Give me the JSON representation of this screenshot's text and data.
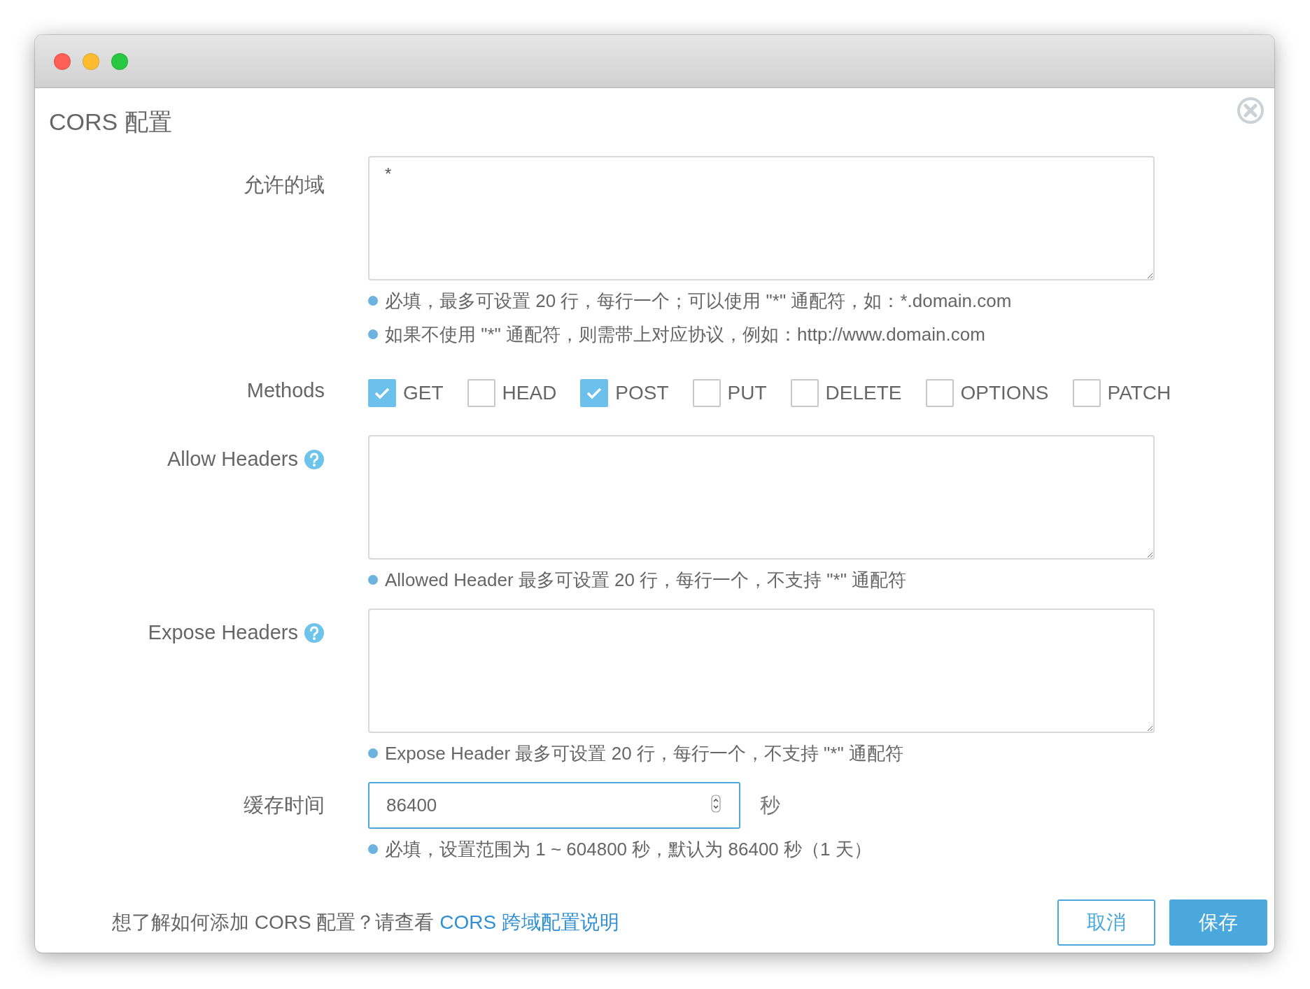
{
  "window": {
    "title": "CORS 配置"
  },
  "allowed_origins": {
    "label": "允许的域",
    "value": "*",
    "hints": [
      "必填，最多可设置 20 行，每行一个；可以使用 \"*\" 通配符，如：*.domain.com",
      "如果不使用 \"*\" 通配符，则需带上对应协议，例如：http://www.domain.com"
    ]
  },
  "methods": {
    "label": "Methods",
    "options": [
      {
        "label": "GET",
        "checked": true
      },
      {
        "label": "HEAD",
        "checked": false
      },
      {
        "label": "POST",
        "checked": true
      },
      {
        "label": "PUT",
        "checked": false
      },
      {
        "label": "DELETE",
        "checked": false
      },
      {
        "label": "OPTIONS",
        "checked": false
      },
      {
        "label": "PATCH",
        "checked": false
      }
    ]
  },
  "allow_headers": {
    "label": "Allow Headers",
    "has_help": true,
    "hints": [
      "Allowed Header 最多可设置 20 行，每行一个，不支持 \"*\" 通配符"
    ]
  },
  "expose_headers": {
    "label": "Expose Headers",
    "has_help": true,
    "hints": [
      "Expose Header 最多可设置 20 行，每行一个，不支持 \"*\" 通配符"
    ]
  },
  "cache_time": {
    "label": "缓存时间",
    "value": "86400",
    "unit": "秒",
    "hints": [
      "必填，设置范围为 1 ~ 604800 秒，默认为 86400 秒（1 天）"
    ]
  },
  "footer": {
    "text": "想了解如何添加 CORS 配置？请查看",
    "link": "CORS 跨域配置说明"
  },
  "buttons": [
    {
      "label": "取消",
      "kind": "secondary"
    },
    {
      "label": "保存",
      "kind": "primary"
    }
  ]
}
